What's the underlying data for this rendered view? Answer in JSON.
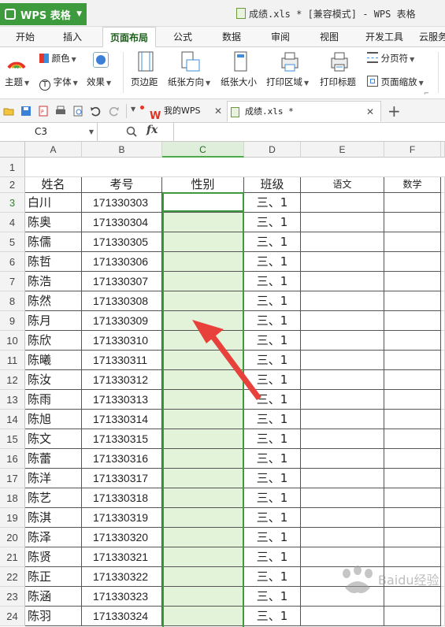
{
  "app": {
    "name": "WPS 表格",
    "doc_title": "成绩.xls * [兼容模式] - WPS 表格"
  },
  "ribbon_tabs": [
    "开始",
    "插入",
    "页面布局",
    "公式",
    "数据",
    "审阅",
    "视图",
    "开发工具",
    "云服务"
  ],
  "active_tab": "页面布局",
  "ribbon": {
    "theme": "主题",
    "color": "颜色",
    "font": "字体",
    "effect": "效果",
    "margins": "页边距",
    "orientation": "纸张方向",
    "paper_size": "纸张大小",
    "print_area": "打印区域",
    "print_titles": "打印标题",
    "page_break": "分页符",
    "page_scale": "页面缩放"
  },
  "doc_tabs": [
    {
      "label": "我的WPS",
      "active": false
    },
    {
      "label": "成绩.xls *",
      "active": true
    }
  ],
  "formula_bar": {
    "cell_ref": "C3",
    "fx": "fx",
    "formula": ""
  },
  "columns": [
    "A",
    "B",
    "C",
    "D",
    "E",
    "F"
  ],
  "selected_column": "C",
  "header_row": {
    "row": "2",
    "cells": [
      "姓名",
      "考号",
      "性别",
      "班级",
      "语文",
      "数学"
    ]
  },
  "rows": [
    {
      "n": "3",
      "name": "白川",
      "id": "171330303",
      "gender": "",
      "class": "三、1"
    },
    {
      "n": "4",
      "name": "陈奥",
      "id": "171330304",
      "gender": "",
      "class": "三、1"
    },
    {
      "n": "5",
      "name": "陈儒",
      "id": "171330305",
      "gender": "",
      "class": "三、1"
    },
    {
      "n": "6",
      "name": "陈哲",
      "id": "171330306",
      "gender": "",
      "class": "三、1"
    },
    {
      "n": "7",
      "name": "陈浩",
      "id": "171330307",
      "gender": "",
      "class": "三、1"
    },
    {
      "n": "8",
      "name": "陈然",
      "id": "171330308",
      "gender": "",
      "class": "三、1"
    },
    {
      "n": "9",
      "name": "陈月",
      "id": "171330309",
      "gender": "",
      "class": "三、1"
    },
    {
      "n": "10",
      "name": "陈欣",
      "id": "171330310",
      "gender": "",
      "class": "三、1"
    },
    {
      "n": "11",
      "name": "陈曦",
      "id": "171330311",
      "gender": "",
      "class": "三、1"
    },
    {
      "n": "12",
      "name": "陈汝",
      "id": "171330312",
      "gender": "",
      "class": "三、1"
    },
    {
      "n": "13",
      "name": "陈雨",
      "id": "171330313",
      "gender": "",
      "class": "三、1"
    },
    {
      "n": "14",
      "name": "陈旭",
      "id": "171330314",
      "gender": "",
      "class": "三、1"
    },
    {
      "n": "15",
      "name": "陈文",
      "id": "171330315",
      "gender": "",
      "class": "三、1"
    },
    {
      "n": "16",
      "name": "陈蕾",
      "id": "171330316",
      "gender": "",
      "class": "三、1"
    },
    {
      "n": "17",
      "name": "陈洋",
      "id": "171330317",
      "gender": "",
      "class": "三、1"
    },
    {
      "n": "18",
      "name": "陈艺",
      "id": "171330318",
      "gender": "",
      "class": "三、1"
    },
    {
      "n": "19",
      "name": "陈淇",
      "id": "171330319",
      "gender": "",
      "class": "三、1"
    },
    {
      "n": "20",
      "name": "陈泽",
      "id": "171330320",
      "gender": "",
      "class": "三、1"
    },
    {
      "n": "21",
      "name": "陈贤",
      "id": "171330321",
      "gender": "",
      "class": "三、1"
    },
    {
      "n": "22",
      "name": "陈正",
      "id": "171330322",
      "gender": "",
      "class": "三、1"
    },
    {
      "n": "23",
      "name": "陈涵",
      "id": "171330323",
      "gender": "",
      "class": "三、1"
    },
    {
      "n": "24",
      "name": "陈羽",
      "id": "171330324",
      "gender": "",
      "class": "三、1"
    }
  ],
  "row1_label": "1",
  "watermark": "Baidu经验",
  "colors": {
    "brand_green": "#3d9a3d",
    "selection_fill": "#e3f3da",
    "arrow_red": "#e8403a"
  }
}
